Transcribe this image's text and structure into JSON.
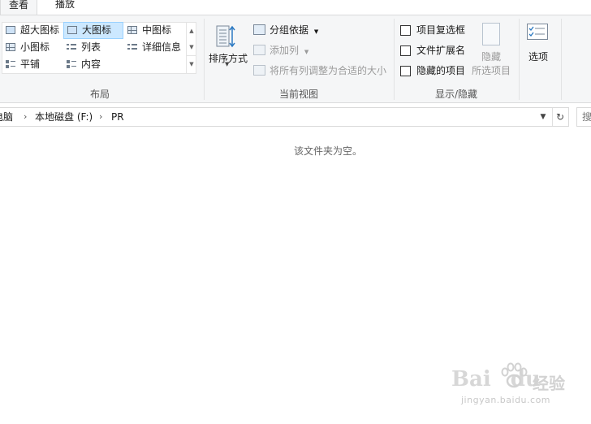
{
  "tabs": [
    {
      "label": "查看",
      "active": true
    },
    {
      "label": "播放",
      "active": false
    }
  ],
  "layout_group": {
    "label": "布局",
    "items": [
      {
        "label": "超大图标",
        "selected": false
      },
      {
        "label": "大图标",
        "selected": true
      },
      {
        "label": "中图标",
        "selected": false
      },
      {
        "label": "小图标",
        "selected": false
      },
      {
        "label": "列表",
        "selected": false
      },
      {
        "label": "详细信息",
        "selected": false
      },
      {
        "label": "平铺",
        "selected": false
      },
      {
        "label": "内容",
        "selected": false
      }
    ]
  },
  "current_view_group": {
    "label": "当前视图",
    "sort_label": "排序方式",
    "group_by_label": "分组依据",
    "add_column_label": "添加列",
    "fit_columns_label": "将所有列调整为合适的大小"
  },
  "show_hide_group": {
    "label": "显示/隐藏",
    "checkboxes": [
      {
        "label": "项目复选框",
        "checked": false
      },
      {
        "label": "文件扩展名",
        "checked": false
      },
      {
        "label": "隐藏的项目",
        "checked": false
      }
    ],
    "hide_selected_line1": "隐藏",
    "hide_selected_line2": "所选项目"
  },
  "options_label": "选项",
  "address": {
    "crumbs": [
      "电脑",
      "本地磁盘 (F:)",
      "PR"
    ],
    "search_placeholder": "搜"
  },
  "empty_message": "该文件夹为空。",
  "watermark": {
    "logo": "Bai",
    "logo2": "du",
    "cn": "经验",
    "url": "jingyan.baidu.com"
  }
}
